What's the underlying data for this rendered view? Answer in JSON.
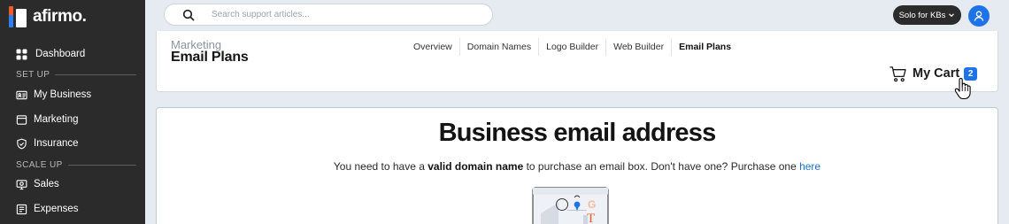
{
  "brand": {
    "name": "afirmo.",
    "colors": {
      "orange": "#f15a24",
      "blue": "#2d7ff9",
      "accent": "#1e73e8",
      "sidebar": "#2b2b2b"
    }
  },
  "sidebar": {
    "items": [
      {
        "label": "Dashboard",
        "icon": "grid-icon"
      },
      {
        "label": "My Business",
        "icon": "id-card-icon"
      },
      {
        "label": "Marketing",
        "icon": "window-icon"
      },
      {
        "label": "Insurance",
        "icon": "shield-check-icon"
      },
      {
        "label": "Sales",
        "icon": "monitor-dollar-icon"
      },
      {
        "label": "Expenses",
        "icon": "receipt-icon"
      }
    ],
    "sections": {
      "setup": "SET UP",
      "scaleup": "SCALE UP"
    }
  },
  "search": {
    "placeholder": "Search support articles...",
    "value": ""
  },
  "account": {
    "plan_label": "Solo for KBs"
  },
  "header": {
    "breadcrumb": "Marketing",
    "title": "Email Plans",
    "tabs": [
      {
        "label": "Overview",
        "active": false
      },
      {
        "label": "Domain Names",
        "active": false
      },
      {
        "label": "Logo Builder",
        "active": false
      },
      {
        "label": "Web Builder",
        "active": false
      },
      {
        "label": "Email Plans",
        "active": true
      }
    ],
    "cart": {
      "label": "My Cart",
      "count": "2"
    }
  },
  "main": {
    "title": "Business email address",
    "sub_pre": "You need to have a ",
    "sub_bold": "valid domain name",
    "sub_post": " to purchase an email box. Don't have one? Purchase one ",
    "sub_link": "here"
  }
}
